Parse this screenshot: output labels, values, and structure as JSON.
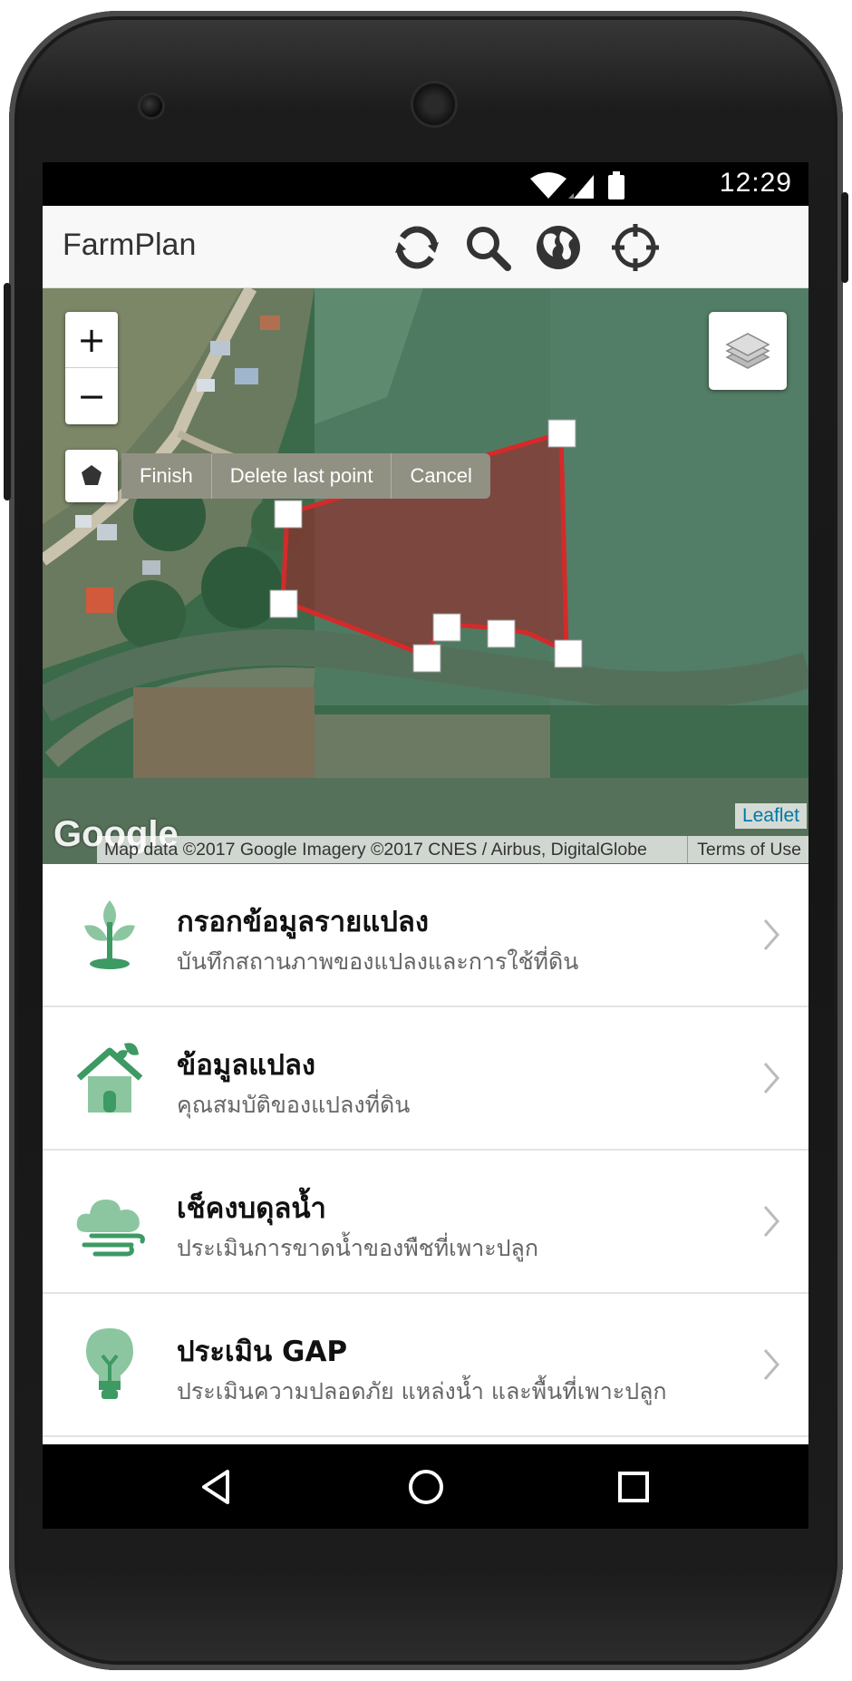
{
  "status_bar": {
    "time": "12:29"
  },
  "app_bar": {
    "title": "FarmPlan",
    "icons": [
      "refresh-icon",
      "search-icon",
      "globe-icon",
      "locate-icon"
    ]
  },
  "map": {
    "zoom_in": "+",
    "zoom_out": "−",
    "draw_toolbar": {
      "finish": "Finish",
      "delete_last": "Delete last point",
      "cancel": "Cancel"
    },
    "google_logo": "Google",
    "attribution": "Map data ©2017 Google Imagery ©2017 CNES / Airbus, DigitalGlobe",
    "terms": "Terms of Use",
    "leaflet": "Leaflet",
    "polygon_color": "#d42a2a"
  },
  "menu": {
    "items": [
      {
        "title": "กรอกข้อมูลรายแปลง",
        "subtitle": "บันทึกสถานภาพของแปลงและการใช้ที่ดิน",
        "icon": "plant-sprout-icon"
      },
      {
        "title": "ข้อมูลแปลง",
        "subtitle": "คุณสมบัติของแปลงที่ดิน",
        "icon": "farm-house-icon"
      },
      {
        "title": "เช็คงบดุลน้ำ",
        "subtitle": "ประเมินการขาดน้ำของพืชที่เพาะปลูก",
        "icon": "cloud-wind-icon"
      },
      {
        "title": "ประเมิน GAP",
        "subtitle": "ประเมินความปลอดภัย แหล่งน้ำ และพื้นที่เพาะปลูก",
        "icon": "lightbulb-icon"
      }
    ]
  },
  "colors": {
    "accent_green": "#3d9a63",
    "light_green": "#8cc6a0"
  }
}
